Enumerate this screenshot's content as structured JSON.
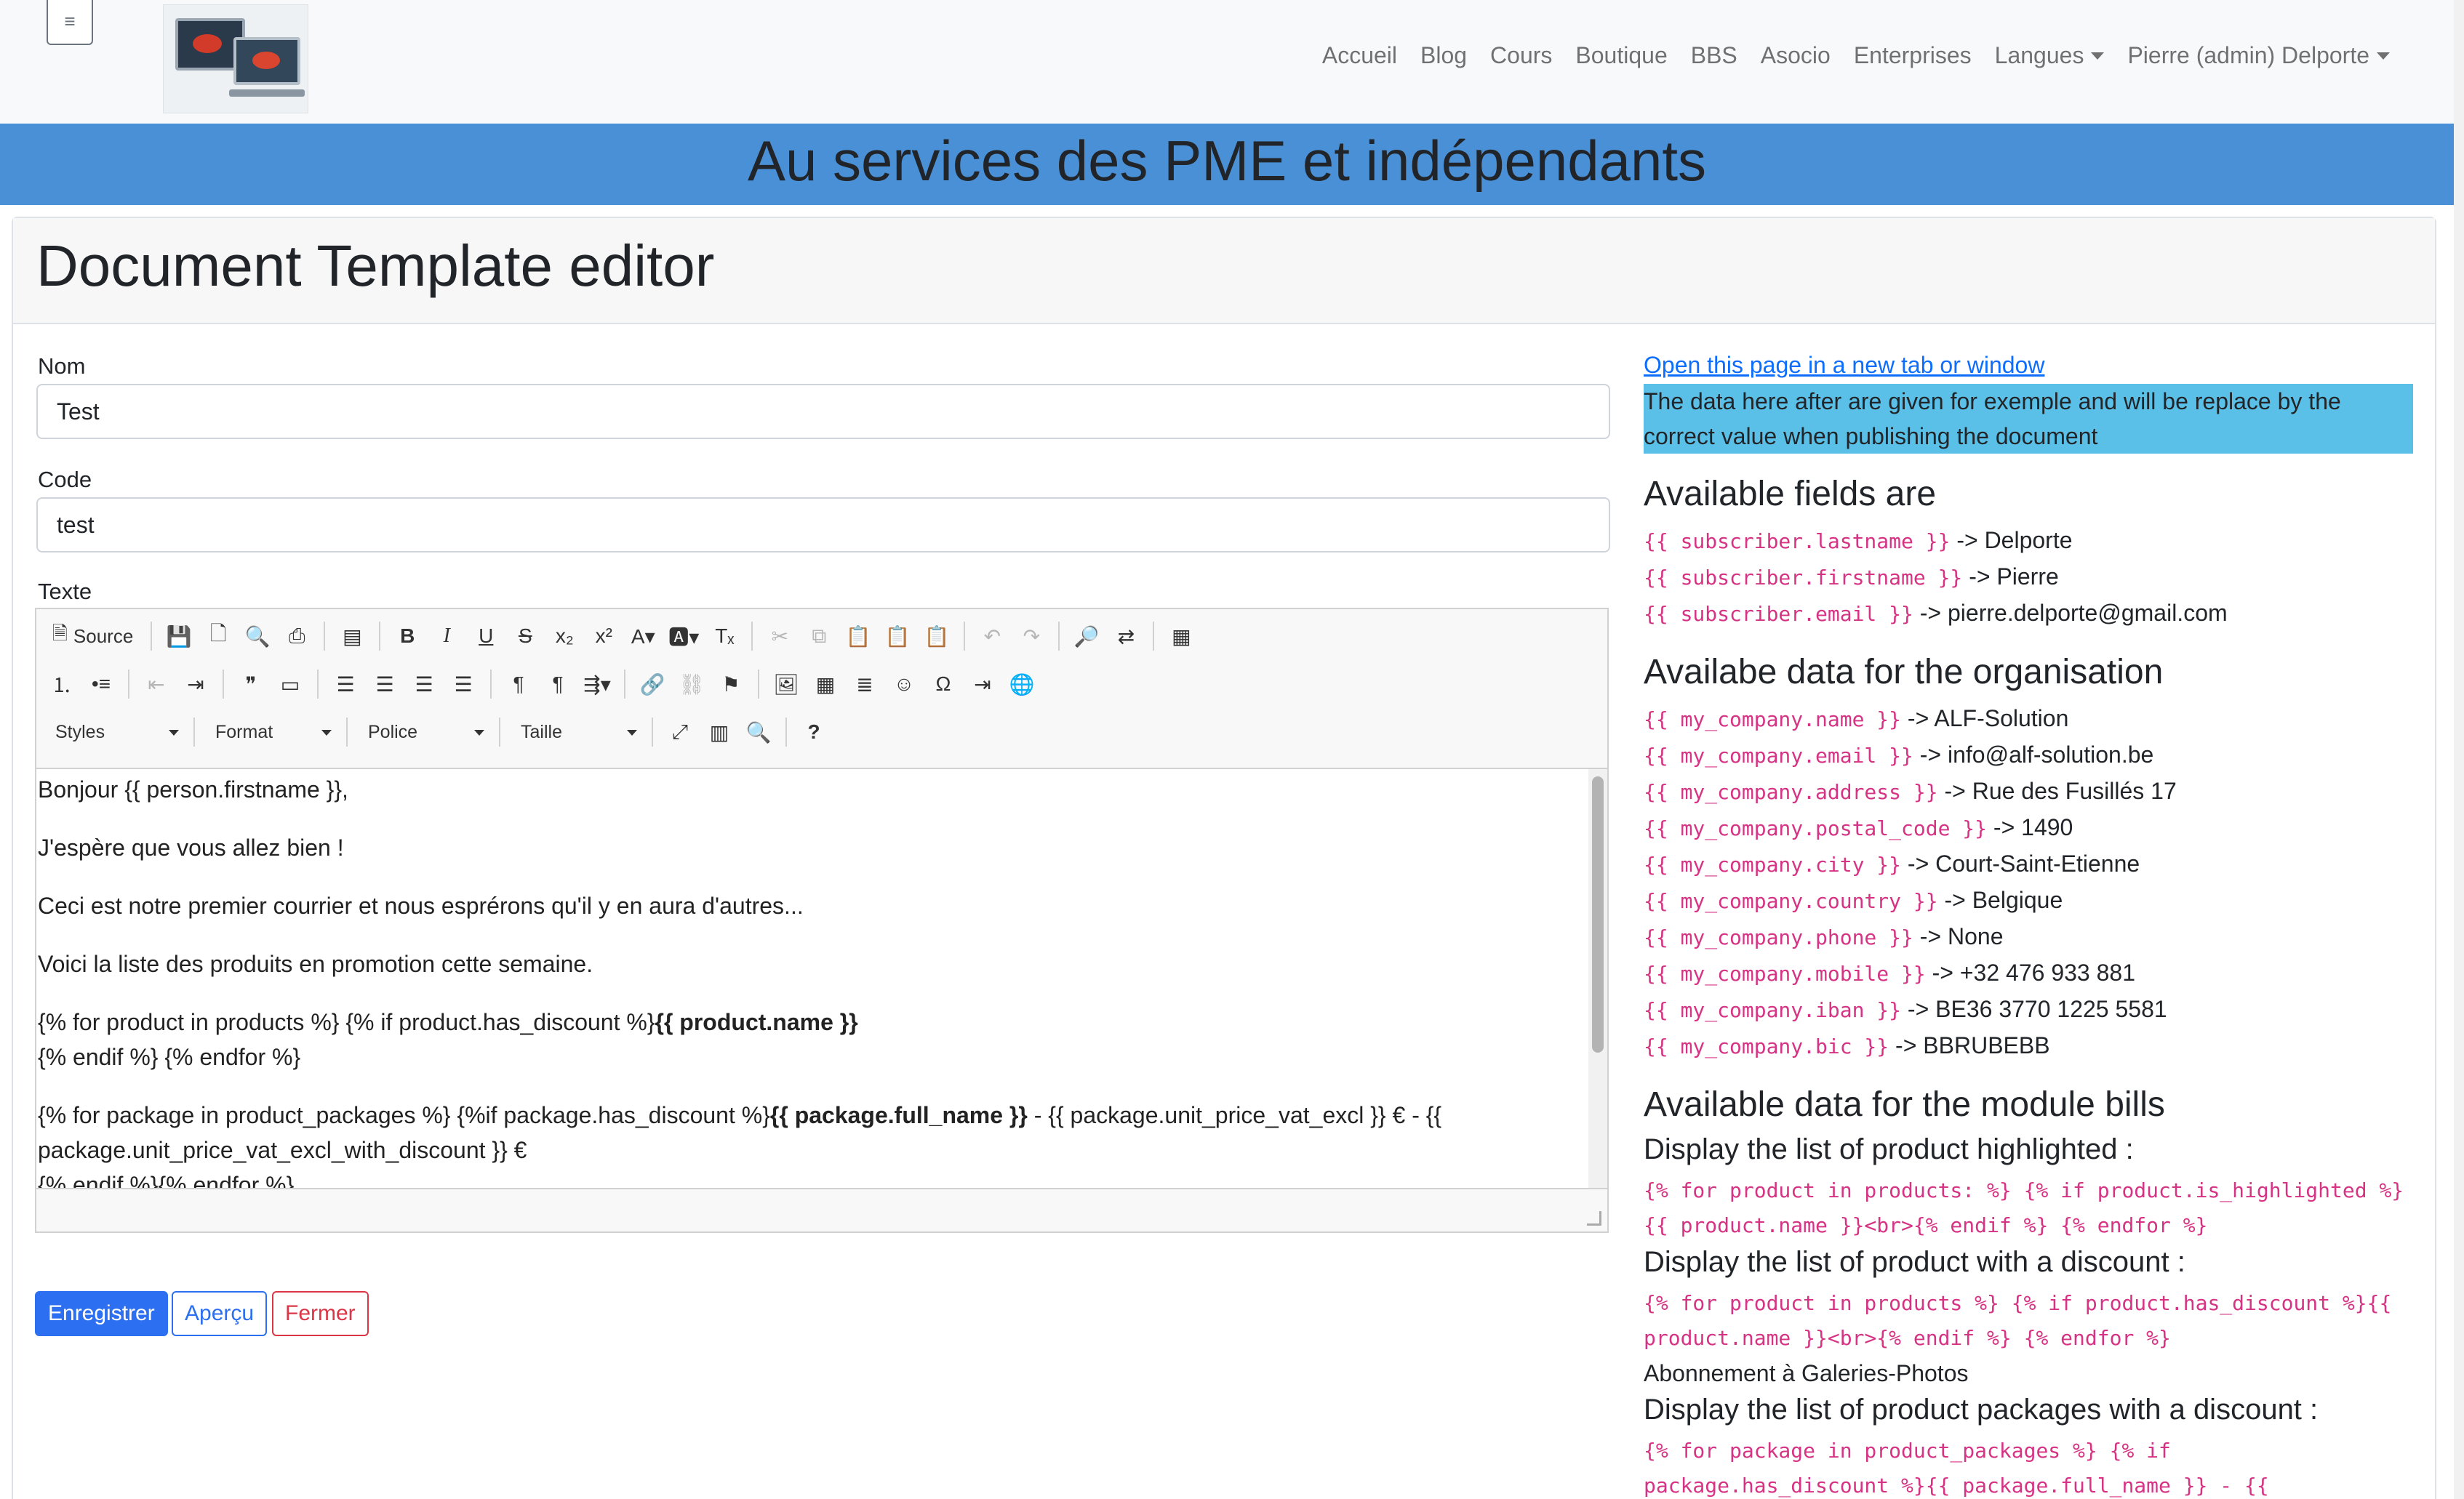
{
  "navbar": {
    "toggle_glyph": "≡",
    "links": [
      "Accueil",
      "Blog",
      "Cours",
      "Boutique",
      "BBS",
      "Asocio",
      "Enterprises"
    ],
    "langues": "Langues",
    "user": "Pierre (admin) Delporte"
  },
  "banner": {
    "title": "Au services des PME et indépendants"
  },
  "page": {
    "title": "Document Template editor"
  },
  "form": {
    "nom_label": "Nom",
    "nom_value": "Test",
    "code_label": "Code",
    "code_value": "test",
    "texte_label": "Texte"
  },
  "editor": {
    "source_label": "Source",
    "combos": [
      "Styles",
      "Format",
      "Police",
      "Taille"
    ],
    "help": "?",
    "content": {
      "p1": "Bonjour {{ person.firstname }},",
      "p2": "J'espère que vous allez bien !",
      "p3": "Ceci est notre premier courrier et nous esprérons qu'il y en aura d'autres...",
      "p4": "Voici la liste des produits en promotion cette semaine.",
      "p5a": "{% for product in products %} {% if product.has_discount %}",
      "p5b": "{{ product.name }}",
      "p5c": "{% endif %} {% endfor %}",
      "p6a": "{% for package in product_packages %} {%if package.has_discount %}",
      "p6b": "{{ package.full_name }}",
      "p6c": " - {{ package.unit_price_vat_excl }} € - {{",
      "p6d": "package.unit_price_vat_excl_with_discount }} €",
      "p6e": "{% endif %}{% endfor %}"
    }
  },
  "buttons": {
    "save": "Enregistrer",
    "preview": "Aperçu",
    "close": "Fermer"
  },
  "right": {
    "open_link": "Open this page in a new tab or window",
    "info": "The data here after are given for exemple and will be replace by the correct value when publishing the document",
    "fields_title": "Available fields are",
    "fields": [
      {
        "code": "{{ subscriber.lastname }}",
        "value": " -> Delporte"
      },
      {
        "code": "{{ subscriber.firstname }}",
        "value": " -> Pierre"
      },
      {
        "code": "{{ subscriber.email }}",
        "value": " -> pierre.delporte@gmail.com"
      }
    ],
    "org_title": "Availabe data for the organisation",
    "org": [
      {
        "code": "{{ my_company.name }}",
        "value": " -> ALF-Solution"
      },
      {
        "code": "{{ my_company.email }}",
        "value": " -> info@alf-solution.be"
      },
      {
        "code": "{{ my_company.address }}",
        "value": " -> Rue des Fusillés 17"
      },
      {
        "code": "{{ my_company.postal_code }}",
        "value": " -> 1490"
      },
      {
        "code": "{{ my_company.city }}",
        "value": " -> Court-Saint-Etienne"
      },
      {
        "code": "{{ my_company.country }}",
        "value": " -> Belgique"
      },
      {
        "code": "{{ my_company.phone }}",
        "value": " -> None"
      },
      {
        "code": "{{ my_company.mobile }}",
        "value": " -> +32 476 933 881"
      },
      {
        "code": "{{ my_company.iban }}",
        "value": " -> BE36 3770 1225 5581"
      },
      {
        "code": "{{ my_company.bic }}",
        "value": " -> BBRUBEBB"
      }
    ],
    "bills_title": "Available data for the module bills",
    "hl_title": "Display the list of product highlighted :",
    "hl_code1": "{% for product in products: %} {% if product.is_highlighted %}",
    "hl_code2": "{{ product.name }}<br>{% endif %} {% endfor %}",
    "disc_title": "Display the list of product with a discount :",
    "disc_code1": "{% for product in products %} {% if product.has_discount %}{{",
    "disc_code2": "product.name }}<br>{% endif %} {% endfor %}",
    "disc_example": "Abonnement à Galeries-Photos",
    "pkg_title": "Display the list of product packages with a discount :",
    "pkg_code1": "{% for package in product_packages %} {% if",
    "pkg_code2": "package.has_discount %}{{ package.full_name }} - {{"
  }
}
